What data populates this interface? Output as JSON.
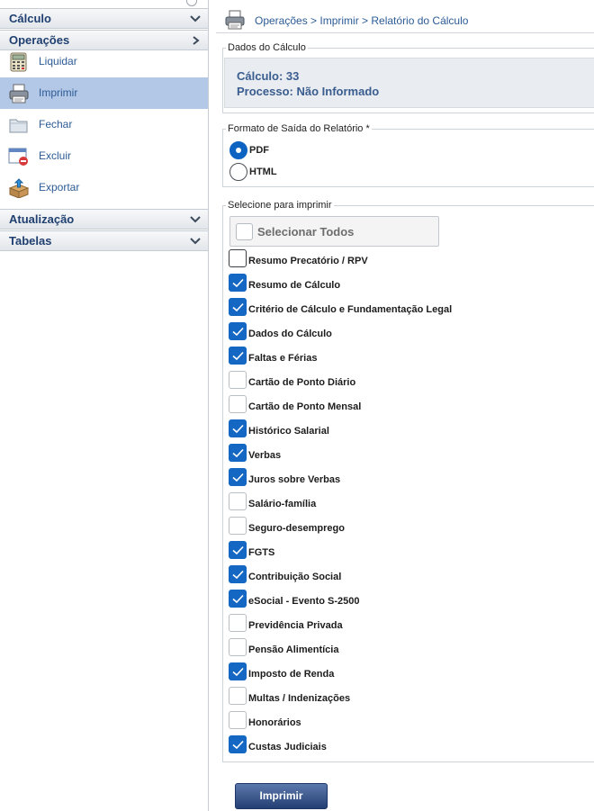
{
  "sidebar": {
    "sections": [
      {
        "label": "Cálculo"
      },
      {
        "label": "Operações"
      },
      {
        "label": "Atualização"
      },
      {
        "label": "Tabelas"
      }
    ],
    "items": [
      {
        "label": "Liquidar",
        "icon": "calculator-icon"
      },
      {
        "label": "Imprimir",
        "icon": "printer-icon"
      },
      {
        "label": "Fechar",
        "icon": "folder-icon"
      },
      {
        "label": "Excluir",
        "icon": "delete-window-icon"
      },
      {
        "label": "Exportar",
        "icon": "export-box-icon"
      }
    ],
    "selected_item": "Imprimir"
  },
  "header": {
    "breadcrumb": "Operações > Imprimir > Relatório do Cálculo",
    "icon": "printer-icon"
  },
  "dados": {
    "legend": "Dados do Cálculo",
    "calculo": "Cálculo: 33",
    "processo": "Processo: Não Informado"
  },
  "formato": {
    "legend": "Formato de Saída do Relatório *",
    "options": [
      {
        "label": "PDF",
        "selected": true
      },
      {
        "label": "HTML",
        "selected": false
      }
    ]
  },
  "selecao": {
    "legend": "Selecione para imprimir",
    "select_all_label": "Selecionar Todos",
    "items": [
      {
        "label": "Resumo Precatório / RPV",
        "checked": false
      },
      {
        "label": "Resumo de Cálculo",
        "checked": true
      },
      {
        "label": "Critério de Cálculo e Fundamentação Legal",
        "checked": true
      },
      {
        "label": "Dados do Cálculo",
        "checked": true
      },
      {
        "label": "Faltas e Férias",
        "checked": true
      },
      {
        "label": "Cartão de Ponto Diário",
        "checked": false
      },
      {
        "label": "Cartão de Ponto Mensal",
        "checked": false
      },
      {
        "label": "Histórico Salarial",
        "checked": true
      },
      {
        "label": "Verbas",
        "checked": true
      },
      {
        "label": "Juros sobre Verbas",
        "checked": true
      },
      {
        "label": "Salário-família",
        "checked": false
      },
      {
        "label": "Seguro-desemprego",
        "checked": false
      },
      {
        "label": "FGTS",
        "checked": true
      },
      {
        "label": "Contribuição Social",
        "checked": true
      },
      {
        "label": "eSocial - Evento S-2500",
        "checked": true
      },
      {
        "label": "Previdência Privada",
        "checked": false
      },
      {
        "label": "Pensão Alimentícia",
        "checked": false
      },
      {
        "label": "Imposto de Renda",
        "checked": true
      },
      {
        "label": "Multas / Indenizações",
        "checked": false
      },
      {
        "label": "Honorários",
        "checked": false
      },
      {
        "label": "Custas Judiciais",
        "checked": true
      }
    ]
  },
  "actions": {
    "print_label": "Imprimir"
  },
  "colors": {
    "accent": "#1467c3",
    "selected_row": "#b3c7e6",
    "link_text": "#2c5b95",
    "button": "#34508a"
  }
}
